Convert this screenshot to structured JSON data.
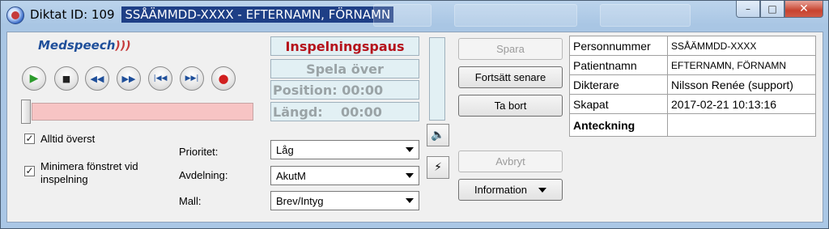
{
  "window": {
    "title_prefix": "Diktat ID: 109",
    "title_subject": "SSÅÄMMDD-XXXX - EFTERNAMN, FÖRNAMN",
    "minimize_glyph": "–",
    "maximize_glyph": "□",
    "close_glyph": "✕"
  },
  "logo": {
    "text": "Medspeech",
    "waves": ")))"
  },
  "transport": {
    "play_glyph": "▶",
    "stop_glyph": "■",
    "rewind_glyph": "◀◀",
    "fastforward_glyph": "▶▶",
    "start_glyph": "|◀◀",
    "end_glyph": "▶▶|",
    "record_glyph": "●"
  },
  "options": {
    "always_on_top": {
      "label": "Alltid överst",
      "checked": true,
      "mark": "✓"
    },
    "minimize_on_record": {
      "label": "Minimera fönstret vid inspelning",
      "checked": true,
      "mark": "✓"
    }
  },
  "status": {
    "state": "Inspelningspaus",
    "playback": "Spela över",
    "position": "Position: 00:00",
    "length": "Längd:    00:00"
  },
  "fields": {
    "priority": {
      "label": "Prioritet:",
      "value": "Låg"
    },
    "department": {
      "label": "Avdelning:",
      "value": "AkutM"
    },
    "template": {
      "label": "Mall:",
      "value": "Brev/Intyg"
    }
  },
  "buttons": {
    "save": "Spara",
    "continue_later": "Fortsätt senare",
    "delete": "Ta bort",
    "cancel": "Avbryt",
    "information": "Information"
  },
  "icons": {
    "speaker": "🔈",
    "magic_wand": "⚡"
  },
  "patient_info": [
    {
      "key": "Personnummer",
      "value": "SSÅÄMMDD-XXXX"
    },
    {
      "key": "Patientnamn",
      "value": "EFTERNAMN, FÖRNAMN"
    },
    {
      "key": "Dikterare",
      "value": "Nilsson Renée (support)"
    },
    {
      "key": "Skapat",
      "value": "2017-02-21 10:13:16"
    },
    {
      "key": "Anteckning",
      "value": ""
    }
  ],
  "colors": {
    "status_red": "#b5121b",
    "slider_track": "#f7c4c4",
    "title_highlight": "#1e3f86"
  }
}
